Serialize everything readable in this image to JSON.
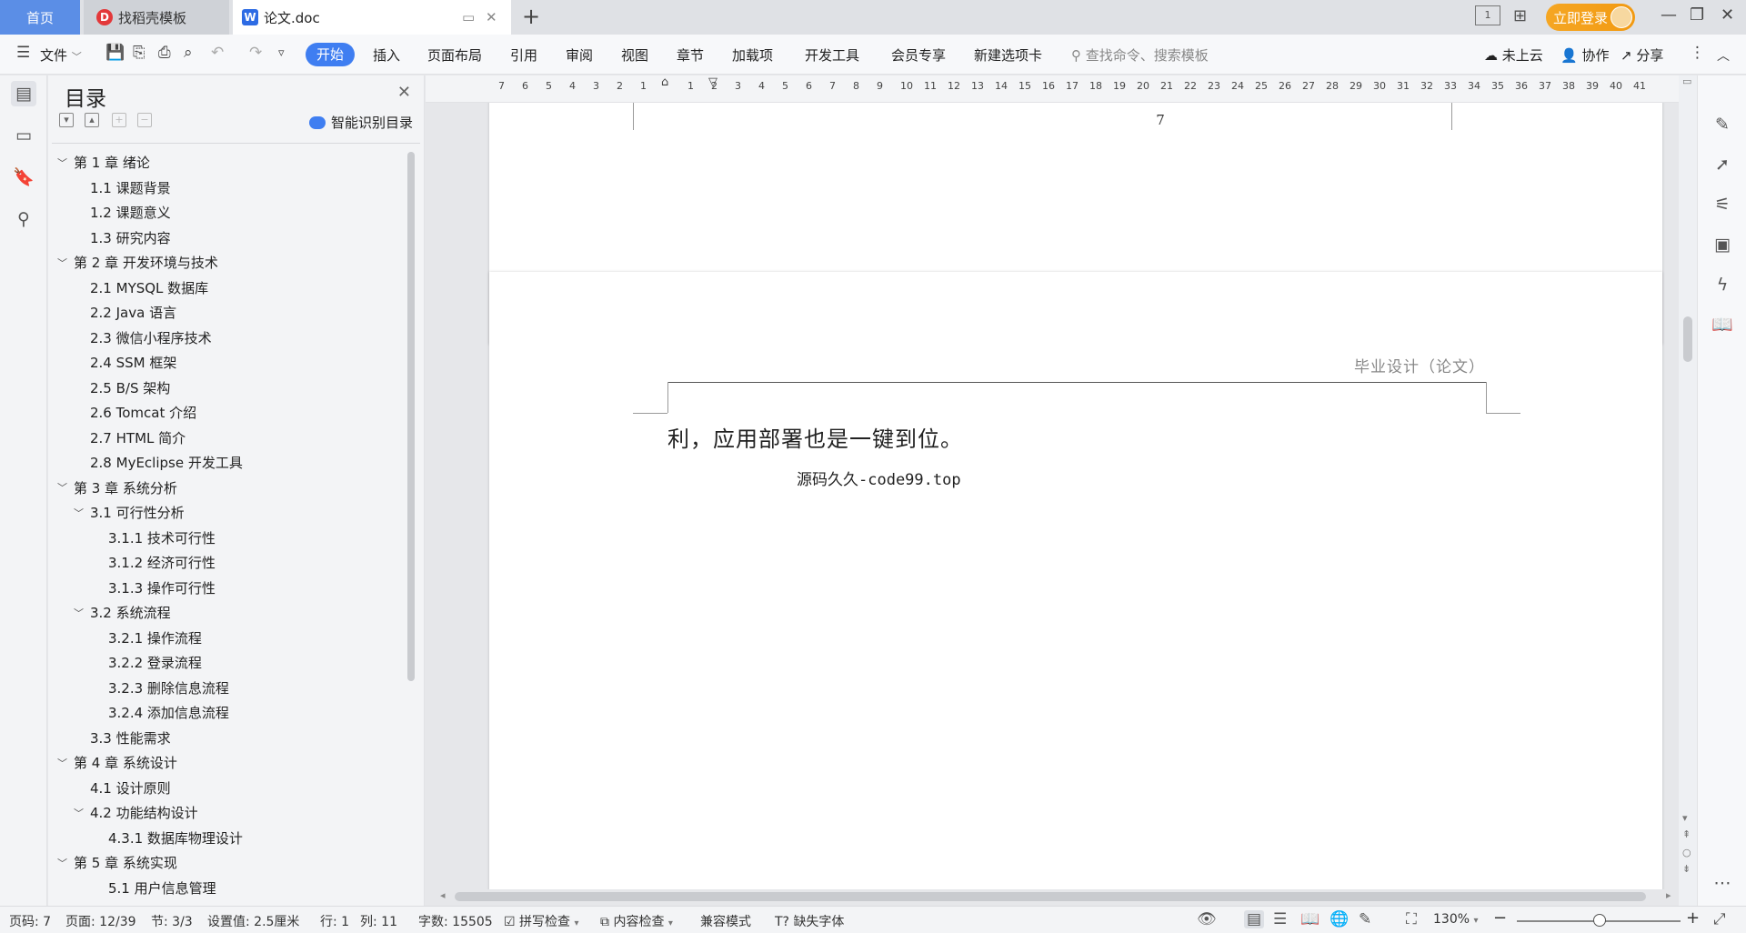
{
  "titlebar": {
    "tabs": [
      {
        "label": "首页"
      },
      {
        "label": "找稻壳模板",
        "icon": "wps-dao-icon"
      },
      {
        "label": "论文.doc",
        "icon": "wps-word-icon"
      }
    ],
    "login_label": "立即登录",
    "layout_badge": "1"
  },
  "menu": {
    "file_label": "文件",
    "start_label": "开始",
    "items": [
      "插入",
      "页面布局",
      "引用",
      "审阅",
      "视图",
      "章节",
      "加载项",
      "开发工具",
      "会员专享",
      "新建选项卡"
    ],
    "search_placeholder": "查找命令、搜索模板",
    "cloud_label": "未上云",
    "collab_label": "协作",
    "share_label": "分享"
  },
  "toc": {
    "title": "目录",
    "smart_label": "智能识别目录",
    "items": [
      {
        "label": "第 1 章  绪论",
        "level": 1,
        "expanded": true
      },
      {
        "label": "1.1  课题背景",
        "level": 2
      },
      {
        "label": "1.2  课题意义",
        "level": 2
      },
      {
        "label": "1.3  研究内容",
        "level": 2
      },
      {
        "label": "第 2 章  开发环境与技术",
        "level": 1,
        "expanded": true
      },
      {
        "label": "2.1  MYSQL 数据库",
        "level": 2
      },
      {
        "label": "2.2  Java 语言",
        "level": 2
      },
      {
        "label": "2.3  微信小程序技术",
        "level": 2
      },
      {
        "label": "2.4  SSM 框架",
        "level": 2
      },
      {
        "label": "2.5  B/S 架构",
        "level": 2
      },
      {
        "label": "2.6  Tomcat  介绍",
        "level": 2
      },
      {
        "label": "2.7  HTML 简介",
        "level": 2
      },
      {
        "label": "2.8  MyEclipse 开发工具",
        "level": 2
      },
      {
        "label": "第 3 章  系统分析",
        "level": 1,
        "expanded": true
      },
      {
        "label": "3.1  可行性分析",
        "level": 2,
        "expanded": true
      },
      {
        "label": "3.1.1  技术可行性",
        "level": 3
      },
      {
        "label": "3.1.2  经济可行性",
        "level": 3
      },
      {
        "label": "3.1.3  操作可行性",
        "level": 3
      },
      {
        "label": "3.2  系统流程",
        "level": 2,
        "expanded": true
      },
      {
        "label": "3.2.1  操作流程",
        "level": 3
      },
      {
        "label": "3.2.2  登录流程",
        "level": 3
      },
      {
        "label": "3.2.3  删除信息流程",
        "level": 3
      },
      {
        "label": "3.2.4  添加信息流程",
        "level": 3
      },
      {
        "label": "3.3  性能需求",
        "level": 2
      },
      {
        "label": "第 4 章  系统设计",
        "level": 1,
        "expanded": true
      },
      {
        "label": "4.1  设计原则",
        "level": 2
      },
      {
        "label": "4.2  功能结构设计",
        "level": 2,
        "expanded": true
      },
      {
        "label": "4.3.1  数据库物理设计",
        "level": 3
      },
      {
        "label": "第 5 章  系统实现",
        "level": 1,
        "expanded": true
      },
      {
        "label": "5.1 用户信息管理",
        "level": 3
      }
    ]
  },
  "ruler": {
    "ticks": [
      "7",
      "6",
      "5",
      "4",
      "3",
      "2",
      "1",
      "",
      "1",
      "2",
      "3",
      "4",
      "5",
      "6",
      "7",
      "8",
      "9",
      "10",
      "11",
      "12",
      "13",
      "14",
      "15",
      "16",
      "17",
      "18",
      "19",
      "20",
      "21",
      "22",
      "23",
      "24",
      "25",
      "26",
      "27",
      "28",
      "29",
      "30",
      "31",
      "32",
      "33",
      "34",
      "35",
      "36",
      "37",
      "38",
      "39",
      "40",
      "41"
    ]
  },
  "document": {
    "prev_page_number": "7",
    "header_text": "毕业设计（论文）",
    "body_line1": "利，应用部署也是一键到位。",
    "body_line2": "源码久久-code99.top"
  },
  "status": {
    "page_code": "页码: 7",
    "page": "页面: 12/39",
    "section": "节: 3/3",
    "setting": "设置值: 2.5厘米",
    "row": "行: 1",
    "col": "列: 11",
    "word_count": "字数: 15505",
    "spellcheck": "拼写检查",
    "content_check": "内容检查",
    "compat_mode": "兼容模式",
    "missing_font": "缺失字体",
    "zoom": "130%",
    "zoom_level_percent": 130
  }
}
